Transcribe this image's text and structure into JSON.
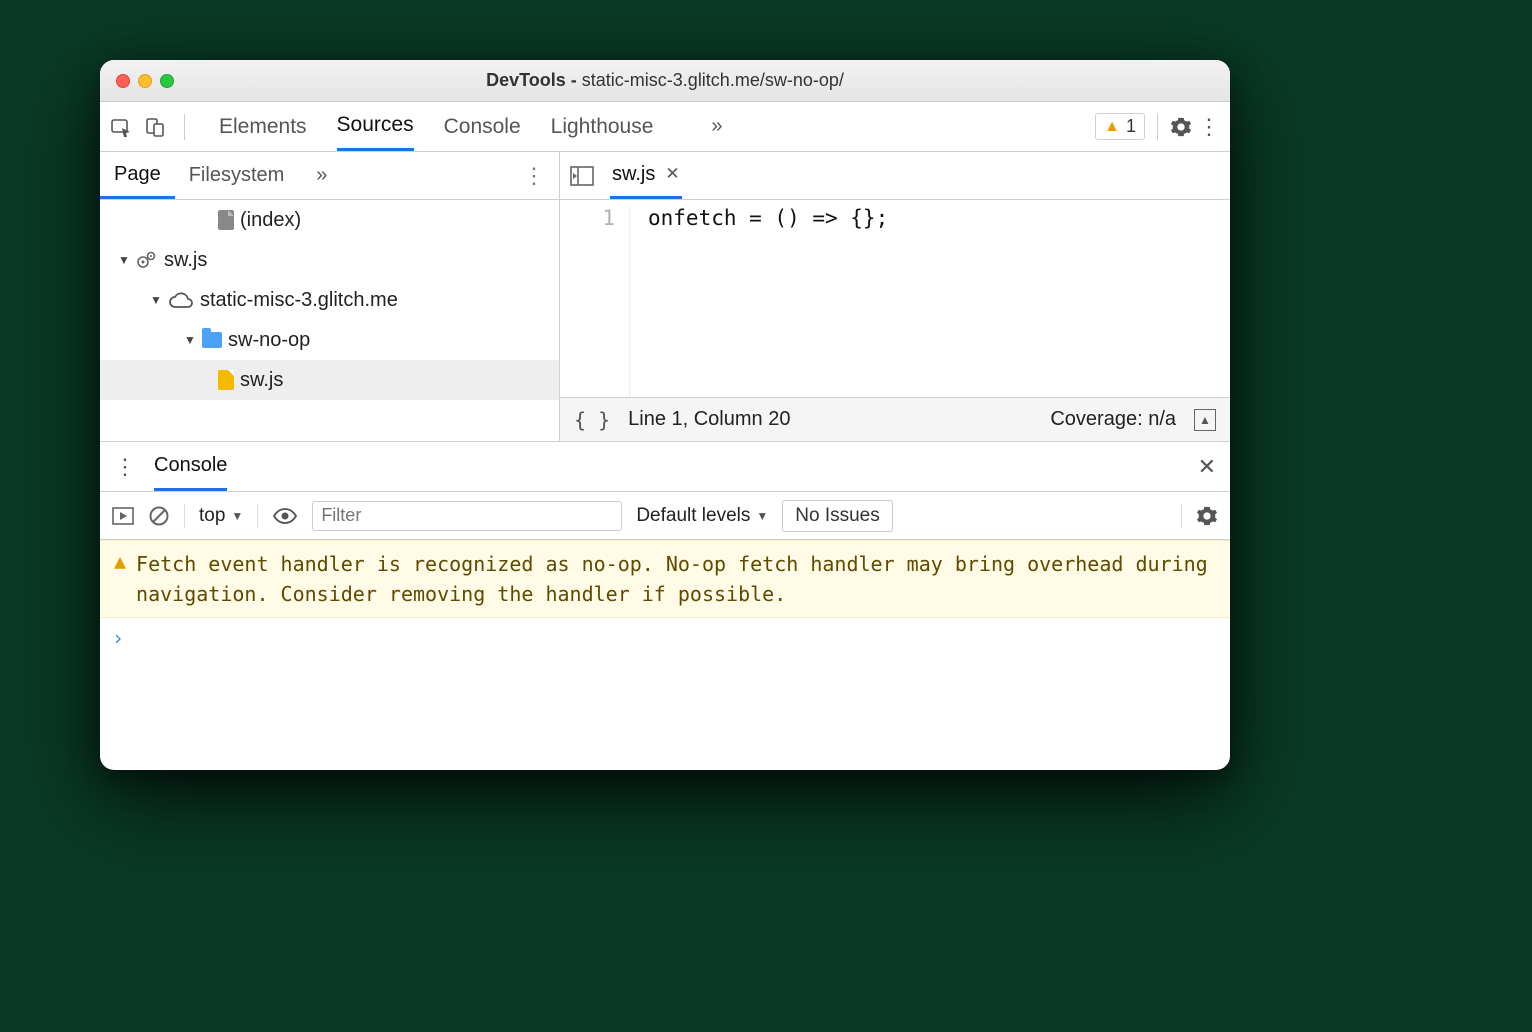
{
  "titlebar": {
    "title_prefix": "DevTools - ",
    "title_path": "static-misc-3.glitch.me/sw-no-op/"
  },
  "toolbar": {
    "tabs": [
      "Elements",
      "Sources",
      "Console",
      "Lighthouse"
    ],
    "active_tab_index": 1,
    "warning_count": "1"
  },
  "sources_sub": {
    "tabs": [
      "Page",
      "Filesystem"
    ],
    "active_index": 0
  },
  "editor": {
    "tab_name": "sw.js",
    "line_number": "1",
    "code": "onfetch = () => {};",
    "status_line_col": "Line 1, Column 20",
    "coverage": "Coverage: n/a"
  },
  "tree": {
    "index_label": "(index)",
    "sw_root": "sw.js",
    "domain": "static-misc-3.glitch.me",
    "folder": "sw-no-op",
    "file": "sw.js"
  },
  "drawer": {
    "tab": "Console",
    "context": "top",
    "filter_placeholder": "Filter",
    "levels_label": "Default levels",
    "no_issues": "No Issues"
  },
  "console_warning": "Fetch event handler is recognized as no-op. No-op fetch handler may bring overhead during navigation. Consider removing the handler if possible.",
  "glyphs": {
    "more": "»",
    "dropdown": "▼",
    "close": "✕",
    "kebab": "⋮",
    "caret": "›"
  }
}
